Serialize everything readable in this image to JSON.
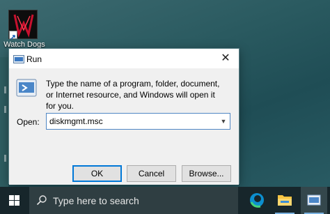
{
  "desktop": {
    "icon_label": "Watch Dogs"
  },
  "run_dialog": {
    "title": "Run",
    "description": "Type the name of a program, folder, document, or Internet resource, and Windows will open it for you.",
    "open_label": "Open:",
    "open_value": "diskmgmt.msc",
    "buttons": {
      "ok": "OK",
      "cancel": "Cancel",
      "browse": "Browse..."
    },
    "close_glyph": "✕"
  },
  "taskbar": {
    "search_placeholder": "Type here to search",
    "apps": [
      "edge-icon",
      "file-explorer-icon",
      "run-icon"
    ]
  },
  "colors": {
    "accent": "#0078d7",
    "taskbar": "#17262b",
    "dialog_bg": "#f0f0f0"
  }
}
